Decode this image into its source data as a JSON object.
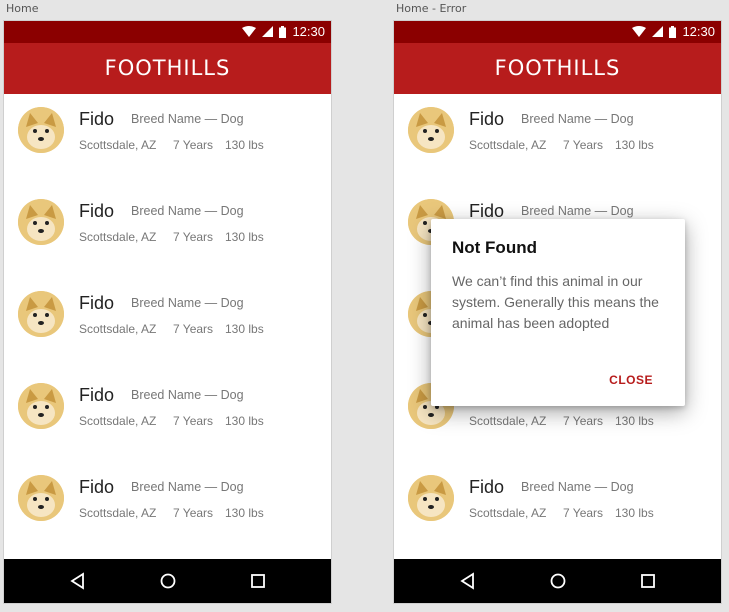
{
  "frames": [
    {
      "label": "Home"
    },
    {
      "label": "Home - Error"
    }
  ],
  "status": {
    "time": "12:30"
  },
  "app": {
    "title": "FOOTHILLS",
    "brand_color": "#b71c1c",
    "status_color": "#8b0000"
  },
  "animals": [
    {
      "name": "Fido",
      "breed": "Breed Name — Dog",
      "location": "Scottsdale, AZ",
      "age": "7 Years",
      "weight": "130 lbs"
    },
    {
      "name": "Fido",
      "breed": "Breed Name — Dog",
      "location": "Scottsdale, AZ",
      "age": "7 Years",
      "weight": "130 lbs"
    },
    {
      "name": "Fido",
      "breed": "Breed Name — Dog",
      "location": "Scottsdale, AZ",
      "age": "7 Years",
      "weight": "130 lbs"
    },
    {
      "name": "Fido",
      "breed": "Breed Name — Dog",
      "location": "Scottsdale, AZ",
      "age": "7 Years",
      "weight": "130 lbs"
    },
    {
      "name": "Fido",
      "breed": "Breed Name — Dog",
      "location": "Scottsdale, AZ",
      "age": "7 Years",
      "weight": "130 lbs"
    }
  ],
  "dialog": {
    "title": "Not Found",
    "body": "We can’t find this animal in our system. Generally this means the animal has been adopted",
    "close_label": "CLOSE"
  },
  "icons": {
    "status": [
      "wifi-icon",
      "signal-icon",
      "battery-icon"
    ],
    "nav": [
      "back-icon",
      "home-icon",
      "recents-icon"
    ],
    "avatar": "dog-avatar-icon"
  }
}
